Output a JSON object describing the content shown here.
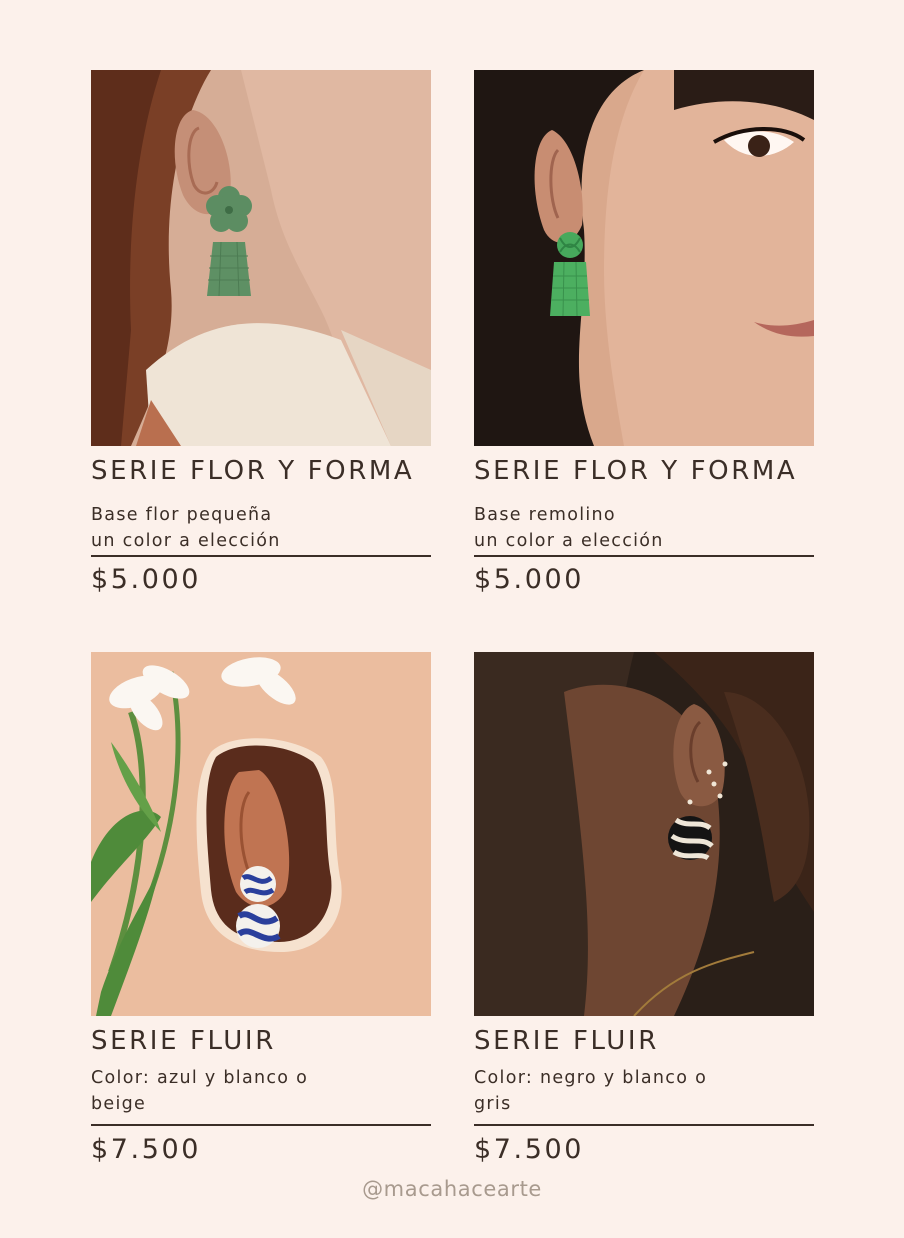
{
  "products": [
    {
      "title": "SERIE FLOR Y FORMA",
      "desc_line1": "Base flor pequeña",
      "desc_line2": "un color a elección",
      "price": "$5.000",
      "earring": "green-flower-earring"
    },
    {
      "title": "SERIE FLOR Y FORMA",
      "desc_line1": "Base remolino",
      "desc_line2": "un color a elección",
      "price": "$5.000",
      "earring": "green-knot-earring"
    },
    {
      "title": "SERIE FLUIR",
      "desc_line1": "Color: azul y blanco o",
      "desc_line2": "beige",
      "price": "$7.500",
      "earring": "blue-white-earring"
    },
    {
      "title": "SERIE FLUIR",
      "desc_line1": "Color: negro y blanco o",
      "desc_line2": "gris",
      "price": "$7.500",
      "earring": "black-white-earring"
    }
  ],
  "footer": {
    "handle": "@macahacearte"
  },
  "colors": {
    "background": "#fcf1eb",
    "text": "#3b2e27",
    "handle": "#a89a8e"
  }
}
